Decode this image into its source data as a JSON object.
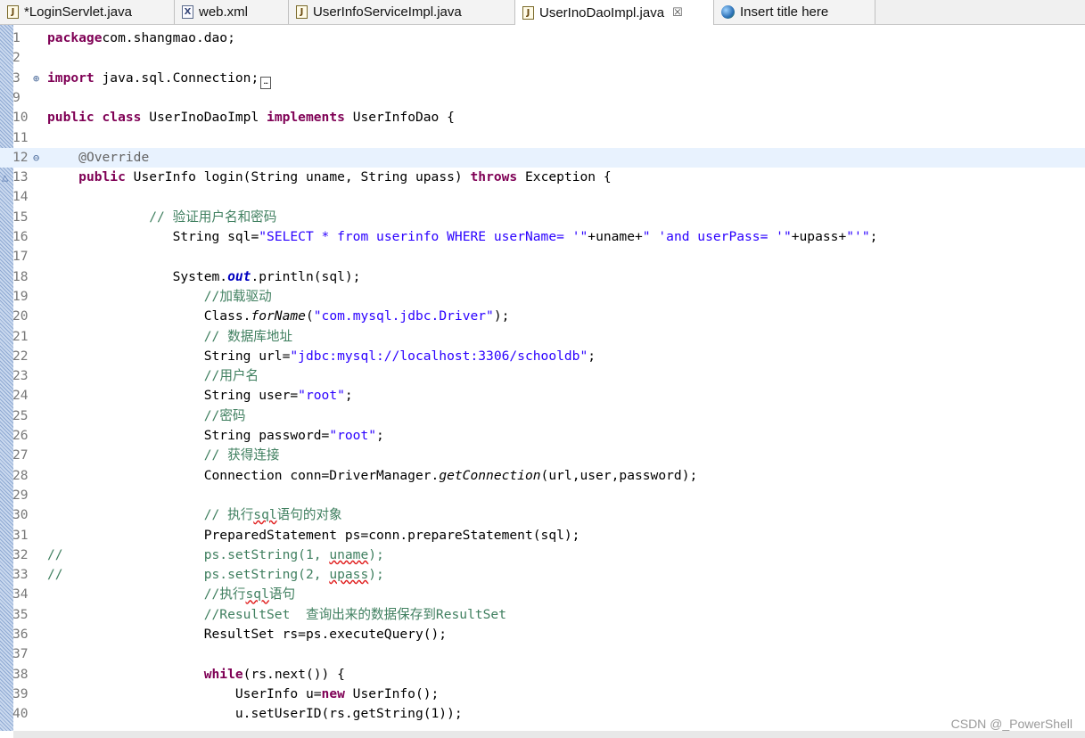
{
  "tabs": [
    {
      "label": "*LoginServlet.java",
      "icon": "java-file-icon"
    },
    {
      "label": "web.xml",
      "icon": "xml-file-icon"
    },
    {
      "label": "UserInfoServiceImpl.java",
      "icon": "java-file-icon"
    },
    {
      "label": "UserInoDaoImpl.java",
      "icon": "java-file-icon",
      "active": true,
      "close": "☒"
    },
    {
      "label": "Insert title here",
      "icon": "browser-globe-icon"
    }
  ],
  "icons": {
    "java": "J",
    "xml": "X",
    "fold_expand": "⊕",
    "fold_collapse": "⊖",
    "override_marker": "△",
    "folded_box": "…"
  },
  "lines": [
    {
      "n": "1",
      "seg": [
        [
          "kw",
          "package"
        ],
        [
          "",
          "com.shangmao.dao;"
        ]
      ]
    },
    {
      "n": "2",
      "seg": []
    },
    {
      "n": "3",
      "seg": [
        [
          "kw",
          "import"
        ],
        [
          "",
          " java.sql.Connection;"
        ]
      ]
    },
    {
      "n": "9",
      "seg": []
    },
    {
      "n": "10",
      "seg": [
        [
          "kw",
          "public class"
        ],
        [
          "",
          " UserInoDaoImpl "
        ],
        [
          "kw",
          "implements"
        ],
        [
          "",
          " UserInfoDao {"
        ]
      ]
    },
    {
      "n": "11",
      "seg": []
    },
    {
      "n": "12",
      "seg": [
        [
          "",
          "    "
        ],
        [
          "an",
          "@Override"
        ]
      ]
    },
    {
      "n": "13",
      "seg": [
        [
          "",
          "    "
        ],
        [
          "kw",
          "public"
        ],
        [
          "",
          " UserInfo login(String "
        ],
        [
          "",
          "uname"
        ],
        [
          "",
          ", String "
        ],
        [
          "",
          "upass"
        ],
        [
          "",
          ") "
        ],
        [
          "kw",
          "throws"
        ],
        [
          "",
          " Exception {"
        ]
      ]
    },
    {
      "n": "14",
      "seg": []
    },
    {
      "n": "15",
      "seg": [
        [
          "",
          "             "
        ],
        [
          "cm",
          "// "
        ],
        [
          "cm cn",
          "验证用户名和密码"
        ]
      ]
    },
    {
      "n": "16",
      "seg": [
        [
          "",
          "                String "
        ],
        [
          "",
          "sql"
        ],
        [
          "",
          "="
        ],
        [
          "str",
          "\"SELECT * from userinfo WHERE userName= '\""
        ],
        [
          "",
          "+uname+"
        ],
        [
          "str",
          "\" 'and userPass= '\""
        ],
        [
          "",
          "+upass+"
        ],
        [
          "str",
          "\"'\""
        ],
        [
          "",
          ";"
        ]
      ]
    },
    {
      "n": "17",
      "seg": []
    },
    {
      "n": "18",
      "seg": [
        [
          "",
          "                System."
        ],
        [
          "fld",
          "out"
        ],
        [
          "",
          ".println(sql);"
        ]
      ]
    },
    {
      "n": "19",
      "seg": [
        [
          "",
          "                    "
        ],
        [
          "cm",
          "//"
        ],
        [
          "cm cn",
          "加载驱动"
        ]
      ]
    },
    {
      "n": "20",
      "seg": [
        [
          "",
          "                    Class."
        ],
        [
          "it",
          "forName"
        ],
        [
          "",
          "("
        ],
        [
          "str",
          "\"com.mysql.jdbc.Driver\""
        ],
        [
          "",
          ");"
        ]
      ]
    },
    {
      "n": "21",
      "seg": [
        [
          "",
          "                    "
        ],
        [
          "cm",
          "// "
        ],
        [
          "cm cn",
          "数据库地址"
        ]
      ]
    },
    {
      "n": "22",
      "seg": [
        [
          "",
          "                    String url="
        ],
        [
          "str",
          "\"jdbc:mysql://localhost:3306/schooldb\""
        ],
        [
          "",
          ";"
        ]
      ]
    },
    {
      "n": "23",
      "seg": [
        [
          "",
          "                    "
        ],
        [
          "cm",
          "//"
        ],
        [
          "cm cn",
          "用户名"
        ]
      ]
    },
    {
      "n": "24",
      "seg": [
        [
          "",
          "                    String user="
        ],
        [
          "str",
          "\"root\""
        ],
        [
          "",
          ";"
        ]
      ]
    },
    {
      "n": "25",
      "seg": [
        [
          "",
          "                    "
        ],
        [
          "cm",
          "//"
        ],
        [
          "cm cn",
          "密码"
        ]
      ]
    },
    {
      "n": "26",
      "seg": [
        [
          "",
          "                    String password="
        ],
        [
          "str",
          "\"root\""
        ],
        [
          "",
          ";"
        ]
      ]
    },
    {
      "n": "27",
      "seg": [
        [
          "",
          "                    "
        ],
        [
          "cm",
          "// "
        ],
        [
          "cm cn",
          "获得连接"
        ]
      ]
    },
    {
      "n": "28",
      "seg": [
        [
          "",
          "                    Connection conn=DriverManager."
        ],
        [
          "it",
          "getConnection"
        ],
        [
          "",
          "(url,user,password);"
        ]
      ]
    },
    {
      "n": "29",
      "seg": []
    },
    {
      "n": "30",
      "seg": [
        [
          "",
          "                    "
        ],
        [
          "cm",
          "// "
        ],
        [
          "cm cn",
          "执行"
        ],
        [
          "cm sq",
          "sql"
        ],
        [
          "cm cn",
          "语句的对象"
        ]
      ]
    },
    {
      "n": "31",
      "seg": [
        [
          "",
          "                    PreparedStatement ps=conn.prepareStatement(sql);"
        ]
      ]
    },
    {
      "n": "32",
      "seg": [
        [
          "cm",
          "//                  ps.setString(1, "
        ],
        [
          "cm sq",
          "uname"
        ],
        [
          "cm",
          ");"
        ]
      ]
    },
    {
      "n": "33",
      "seg": [
        [
          "cm",
          "//                  ps.setString(2, "
        ],
        [
          "cm sq",
          "upass"
        ],
        [
          "cm",
          ");"
        ]
      ]
    },
    {
      "n": "34",
      "seg": [
        [
          "",
          "                    "
        ],
        [
          "cm",
          "//"
        ],
        [
          "cm cn",
          "执行"
        ],
        [
          "cm sq",
          "sql"
        ],
        [
          "cm cn",
          "语句"
        ]
      ]
    },
    {
      "n": "35",
      "seg": [
        [
          "",
          "                    "
        ],
        [
          "cm",
          "//ResultSet  "
        ],
        [
          "cm cn",
          "查询出来的数据保存到"
        ],
        [
          "cm",
          "ResultSet"
        ]
      ]
    },
    {
      "n": "36",
      "seg": [
        [
          "",
          "                    ResultSet rs=ps.executeQuery();"
        ]
      ]
    },
    {
      "n": "37",
      "seg": []
    },
    {
      "n": "38",
      "seg": [
        [
          "",
          "                    "
        ],
        [
          "kw",
          "while"
        ],
        [
          "",
          "(rs.next()) {"
        ]
      ]
    },
    {
      "n": "39",
      "seg": [
        [
          "",
          "                        UserInfo u="
        ],
        [
          "kw",
          "new"
        ],
        [
          "",
          " UserInfo();"
        ]
      ]
    },
    {
      "n": "40",
      "seg": [
        [
          "",
          "                        u.setUserID(rs.getString(1));"
        ]
      ]
    }
  ],
  "watermark": "CSDN @_PowerShell"
}
